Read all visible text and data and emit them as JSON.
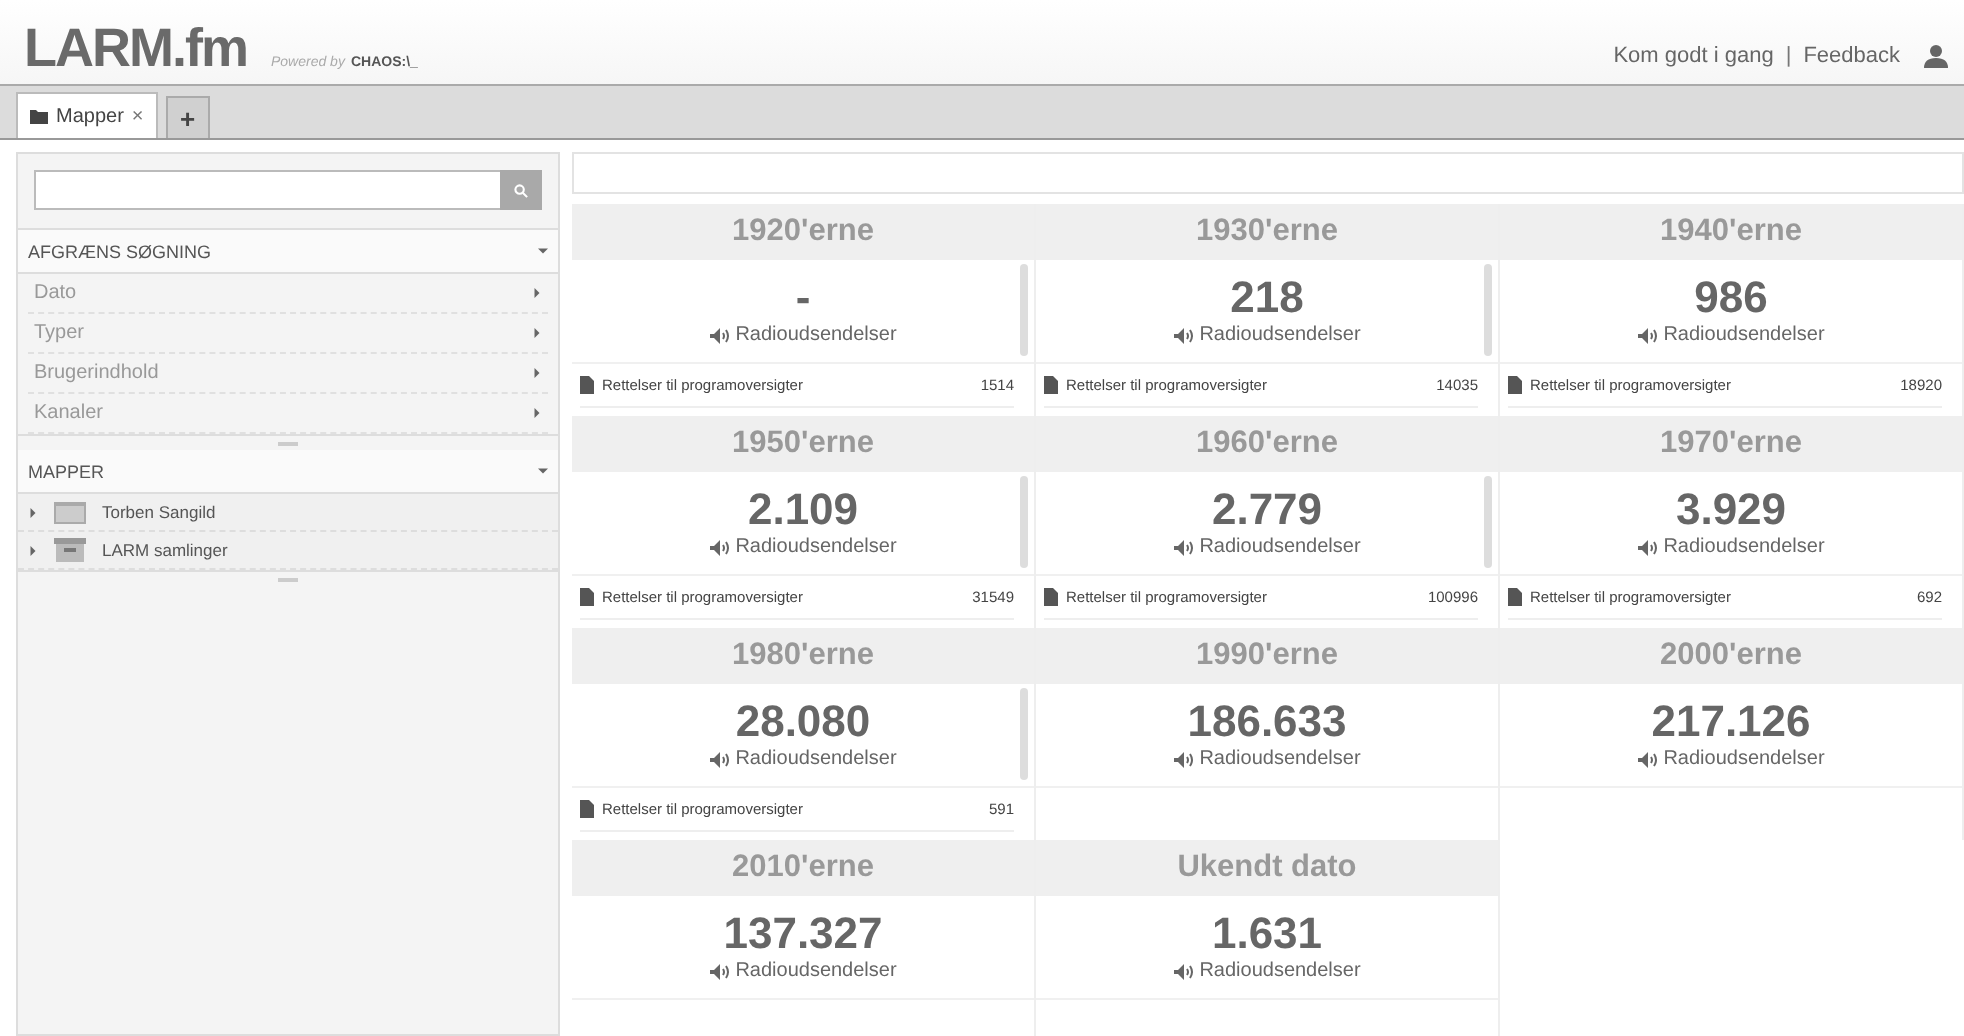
{
  "header": {
    "logo": "LARM.fm",
    "powered_by": "Powered by",
    "powered_brand": "CHAOS:\\_",
    "links": [
      "Kom godt i gang",
      "Feedback"
    ],
    "separator": "|"
  },
  "tabs": [
    {
      "label": "Mapper",
      "selected": true,
      "close": "×"
    }
  ],
  "add_tab": "+",
  "sidebar": {
    "sections": [
      {
        "title": "AFGRÆNS SØGNING",
        "expanded": true,
        "kind": "filters",
        "items": [
          {
            "label": "Dato"
          },
          {
            "label": "Typer"
          },
          {
            "label": "Brugerindhold"
          },
          {
            "label": "Kanaler"
          }
        ]
      },
      {
        "title": "MAPPER",
        "expanded": true,
        "kind": "folders",
        "items": [
          {
            "label": "Torben Sangild",
            "kind": "folder"
          },
          {
            "label": "LARM samlinger",
            "kind": "archive"
          }
        ]
      }
    ]
  },
  "decades": [
    {
      "title": "1920'erne",
      "count": "-",
      "type": "Radioudsendelser",
      "scrollbar": true,
      "correction": {
        "label": "Rettelser til programoversigter",
        "count": "1514"
      }
    },
    {
      "title": "1930'erne",
      "count": "218",
      "type": "Radioudsendelser",
      "scrollbar": true,
      "correction": {
        "label": "Rettelser til programoversigter",
        "count": "14035"
      }
    },
    {
      "title": "1940'erne",
      "count": "986",
      "type": "Radioudsendelser",
      "scrollbar": false,
      "correction": {
        "label": "Rettelser til programoversigter",
        "count": "18920"
      }
    },
    {
      "title": "1950'erne",
      "count": "2.109",
      "type": "Radioudsendelser",
      "scrollbar": true,
      "correction": {
        "label": "Rettelser til programoversigter",
        "count": "31549"
      }
    },
    {
      "title": "1960'erne",
      "count": "2.779",
      "type": "Radioudsendelser",
      "scrollbar": true,
      "correction": {
        "label": "Rettelser til programoversigter",
        "count": "100996"
      }
    },
    {
      "title": "1970'erne",
      "count": "3.929",
      "type": "Radioudsendelser",
      "scrollbar": false,
      "correction": {
        "label": "Rettelser til programoversigter",
        "count": "692"
      }
    },
    {
      "title": "1980'erne",
      "count": "28.080",
      "type": "Radioudsendelser",
      "scrollbar": true,
      "correction": {
        "label": "Rettelser til programoversigter",
        "count": "591"
      }
    },
    {
      "title": "1990'erne",
      "count": "186.633",
      "type": "Radioudsendelser",
      "scrollbar": false
    },
    {
      "title": "2000'erne",
      "count": "217.126",
      "type": "Radioudsendelser",
      "scrollbar": false
    },
    {
      "title": "2010'erne",
      "count": "137.327",
      "type": "Radioudsendelser",
      "scrollbar": false
    },
    {
      "title": "Ukendt dato",
      "count": "1.631",
      "type": "Radioudsendelser",
      "scrollbar": false
    }
  ]
}
